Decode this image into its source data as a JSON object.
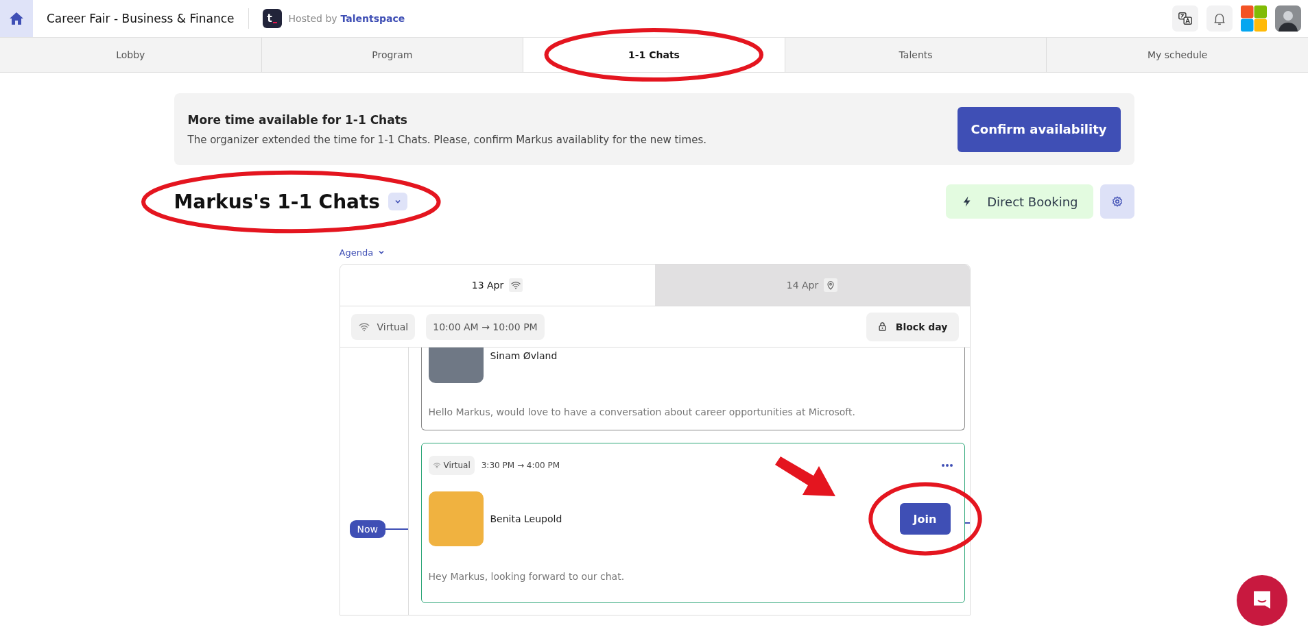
{
  "header": {
    "title": "Career Fair - Business & Finance",
    "hosted_prefix": "Hosted by",
    "host": "Talentspace",
    "logo_letter": "t"
  },
  "nav_tabs": [
    {
      "label": "Lobby",
      "selected": false,
      "circled": false
    },
    {
      "label": "Program",
      "selected": false,
      "circled": false
    },
    {
      "label": "1-1 Chats",
      "selected": true,
      "circled": true
    },
    {
      "label": "Talents",
      "selected": false,
      "circled": false
    },
    {
      "label": "My schedule",
      "selected": false,
      "circled": false
    }
  ],
  "banner": {
    "title": "More time available for 1-1 Chats",
    "text": "The organizer extended the time for 1-1 Chats. Please, confirm Markus availablity for the new times.",
    "button": "Confirm availability"
  },
  "page_heading": {
    "title": "Markus's 1-1 Chats",
    "circled": true
  },
  "direct_booking": "Direct Booking",
  "view_selector": "Agenda",
  "day_tabs": [
    {
      "label": "13 Apr",
      "kind": "virtual",
      "selected": true
    },
    {
      "label": "14 Apr",
      "kind": "onsite",
      "selected": false
    }
  ],
  "day_toolbar": {
    "mode": "Virtual",
    "hours": "10:00 AM → 10:00 PM",
    "block_button": "Block day"
  },
  "chats": [
    {
      "name": "Sinam Øvland",
      "message": "Hello Markus, would love to have a conversation about career opportunities at Microsoft.",
      "current": false,
      "clipped": true
    },
    {
      "mode": "Virtual",
      "time": "3:30 PM → 4:00 PM",
      "name": "Benita Leupold",
      "message": "Hey Markus, looking forward to our chat.",
      "current": true,
      "clipped": false,
      "now_label": "Now",
      "join": {
        "label": "Join",
        "circled": true,
        "arrow": true
      }
    }
  ]
}
